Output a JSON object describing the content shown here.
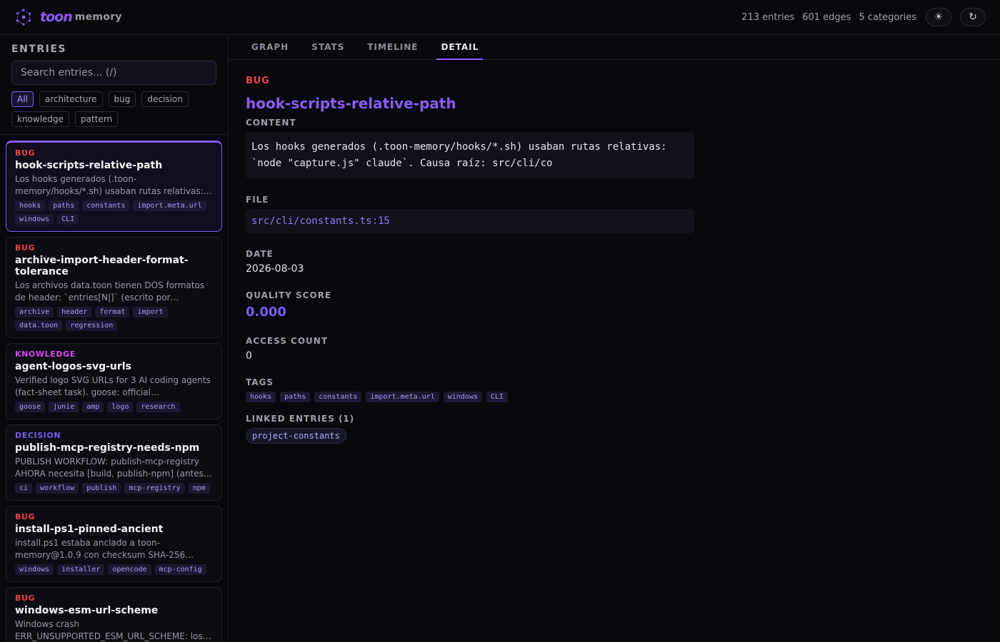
{
  "header": {
    "brand_name": "toon",
    "brand_sub": "memory",
    "entries": "213 entries",
    "edges": "601 edges",
    "categories": "5 categories",
    "theme_icon": "☀",
    "refresh_icon": "↻"
  },
  "sidebar": {
    "title": "ENTRIES",
    "search_placeholder": "Search entries... (/)",
    "filters": [
      "All",
      "architecture",
      "bug",
      "decision",
      "knowledge",
      "pattern"
    ],
    "active_filter": "All"
  },
  "entries": [
    {
      "category": "BUG",
      "title": "hook-scripts-relative-path",
      "desc": "Los hooks generados (.toon-memory/hooks/*.sh) usaban rutas relativas:…",
      "tags": [
        "hooks",
        "paths",
        "constants",
        "import.meta.url",
        "windows",
        "CLI"
      ]
    },
    {
      "category": "BUG",
      "title": "archive-import-header-format-tolerance",
      "desc": "Los archivos data.toon tienen DOS formatos de header: `entries[N|]` (escrito por…",
      "tags": [
        "archive",
        "header",
        "format",
        "import",
        "data.toon",
        "regression"
      ]
    },
    {
      "category": "KNOWLEDGE",
      "title": "agent-logos-svg-urls",
      "desc": "Verified logo SVG URLs for 3 AI coding agents (fact-sheet task). goose: official…",
      "tags": [
        "goose",
        "junie",
        "amp",
        "logo",
        "research"
      ]
    },
    {
      "category": "DECISION",
      "title": "publish-mcp-registry-needs-npm",
      "desc": "PUBLISH WORKFLOW: publish-mcp-registry AHORA necesita [build, publish-npm] (antes…",
      "tags": [
        "ci",
        "workflow",
        "publish",
        "mcp-registry",
        "npm"
      ]
    },
    {
      "category": "BUG",
      "title": "install-ps1-pinned-ancient",
      "desc": "install.ps1 estaba anclado a toon-memory@1.0.9 con checksum SHA-256…",
      "tags": [
        "windows",
        "installer",
        "opencode",
        "mcp-config"
      ]
    },
    {
      "category": "BUG",
      "title": "windows-esm-url-scheme",
      "desc": "Windows crash ERR_UNSUPPORTED_ESM_URL_SCHEME: los…",
      "tags": []
    }
  ],
  "tabs": [
    "GRAPH",
    "STATS",
    "TIMELINE",
    "DETAIL"
  ],
  "active_tab": "DETAIL",
  "detail": {
    "category": "BUG",
    "title": "hook-scripts-relative-path",
    "content_label": "CONTENT",
    "content": "Los hooks generados (.toon-memory/hooks/*.sh) usaban rutas relativas: `node \"capture.js\" claude`. Causa raíz: src/cli/co",
    "file_label": "FILE",
    "file": "src/cli/constants.ts:15",
    "date_label": "DATE",
    "date": "2026-08-03",
    "quality_label": "QUALITY SCORE",
    "quality": "0.000",
    "access_label": "ACCESS COUNT",
    "access": "0",
    "tags_label": "TAGS",
    "tags": [
      "hooks",
      "paths",
      "constants",
      "import.meta.url",
      "windows",
      "CLI"
    ],
    "linked_label": "LINKED ENTRIES (1)",
    "linked": [
      "project-constants"
    ]
  },
  "colors": {
    "accent": "#8b5cf6",
    "bug": "#ef4444",
    "knowledge": "#d946ef",
    "decision": "#7c5cf0"
  }
}
